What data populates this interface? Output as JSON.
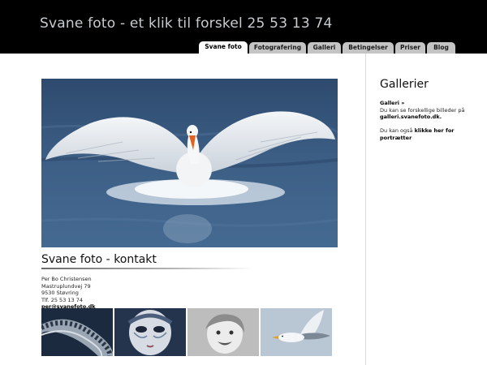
{
  "header": {
    "site_title": "Svane foto - et klik til forskel 25 53 13 74"
  },
  "nav": {
    "tabs": [
      {
        "label": "Svane foto",
        "active": true
      },
      {
        "label": "Fotografering",
        "active": false
      },
      {
        "label": "Galleri",
        "active": false
      },
      {
        "label": "Betingelser",
        "active": false
      },
      {
        "label": "Priser",
        "active": false
      },
      {
        "label": "Blog",
        "active": false
      }
    ]
  },
  "main": {
    "hero_image": "swan-landing-on-water",
    "section_title": "Svane foto - kontakt",
    "contact": {
      "name": "Per Bo Christensen",
      "street": "Mastruplundvej 79",
      "city": "9530 Støvring",
      "phone": "Tlf. 25 53 13 74",
      "email": "per@svanefoto.dk"
    },
    "thumbnails": [
      "film-reel",
      "venetian-mask",
      "smiling-child",
      "seagull"
    ]
  },
  "sidebar": {
    "title": "Gallerier",
    "gallery_link": "Galleri »",
    "gallery_text": "Du kan se forskellige billeder på",
    "gallery_url": "galleri.svanefoto.dk.",
    "portrait_text": "Du kan også",
    "portrait_link": "klikke her for portrætter"
  },
  "colors": {
    "header_bg": "#000000",
    "title_text": "#c8ccd0",
    "tab_bg": "#c4c4c4",
    "tab_active_bg": "#ffffff"
  }
}
